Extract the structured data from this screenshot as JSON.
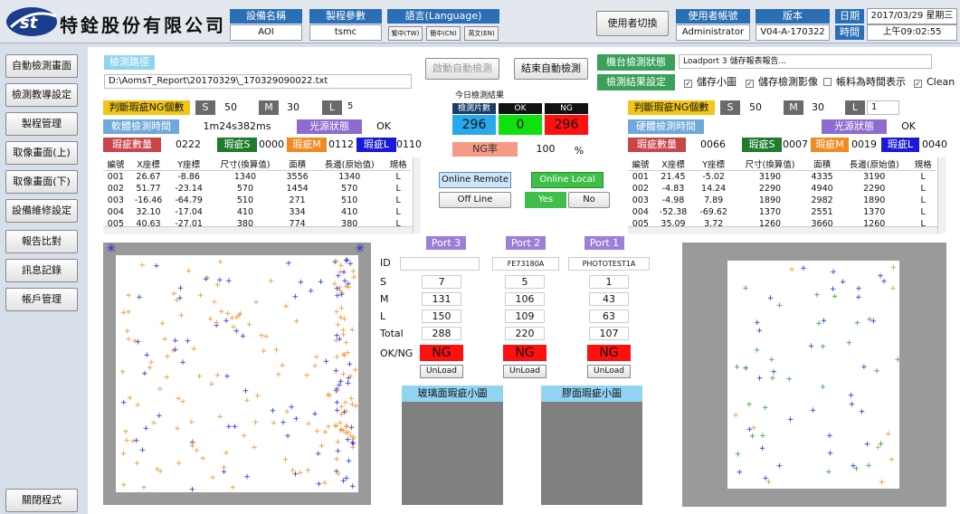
{
  "company": {
    "logo_text": "st",
    "name": "特銓股份有限公司"
  },
  "header": {
    "device_label": "設備名稱",
    "device_value": "AOI",
    "recipe_label": "製程參數",
    "recipe_value": "tsmc",
    "lang_label": "語言(Language)",
    "lang_tw": "繁中(TW)",
    "lang_cn": "簡中(CN)",
    "lang_en": "英文(EN)",
    "switch_user": "使用者切換",
    "account_label": "使用者帳號",
    "account_value": "Administrator",
    "version_label": "版本",
    "version_value": "V04-A-170322",
    "date_label": "日期",
    "date_value": "2017/03/29 星期三",
    "time_label": "時間",
    "time_value": "上午09:02:55"
  },
  "sidebar": [
    "自動檢測畫面",
    "檢測教導設定",
    "製程管理",
    "取像畫面(上)",
    "取像畫面(下)",
    "設備維修設定",
    "報告比對",
    "訊息記錄",
    "帳戶管理"
  ],
  "close_button": "關閉程式",
  "path": {
    "label": "檢測路徑",
    "value": "D:\\AomsT_Report\\20170329\\_170329090022.txt"
  },
  "auto": {
    "start": "啟動自動檢測",
    "end": "結束自動檢測"
  },
  "machine": {
    "status_label": "機台檢測狀態",
    "status_value": "Loadport 3 儲存報表報告...",
    "result_label": "檢測結果設定"
  },
  "options": [
    {
      "label": "儲存小圖",
      "checked": true
    },
    {
      "label": "儲存檢測影像",
      "checked": true
    },
    {
      "label": "帳料為時間表示",
      "checked": false
    },
    {
      "label": "Clean",
      "checked": true
    }
  ],
  "today": {
    "title": "今日檢測結果",
    "count_label": "檢測片數",
    "ok_label": "OK",
    "ng_label": "NG",
    "count": "296",
    "ok": "0",
    "ng": "296",
    "rate_label": "NG率",
    "rate": "100",
    "rate_unit": "%"
  },
  "online": {
    "remote": "Online Remote",
    "local": "Online Local",
    "offline": "Off Line",
    "yes": "Yes",
    "no": "No"
  },
  "left": {
    "ng_label": "判斷瑕疵NG個數",
    "s": "S",
    "s_val": "50",
    "m": "M",
    "m_val": "30",
    "l": "L",
    "l_val": "5",
    "time_label": "軟體檢測時間",
    "time_val": "1m24s382ms",
    "light_label": "光源狀態",
    "light_val": "OK",
    "count_label": "瑕疵數量",
    "count_val": "0222",
    "ds": "瑕疵S",
    "ds_val": "0000",
    "dm": "瑕疵M",
    "dm_val": "0112",
    "dl": "瑕疵L",
    "dl_val": "0110",
    "columns": [
      "編號",
      "X座標",
      "Y座標",
      "尺寸(換算值)",
      "面積",
      "長邊(原始值)",
      "規格"
    ],
    "rows": [
      [
        "001",
        "26.67",
        "-8.86",
        "1340",
        "3556",
        "1340",
        "L"
      ],
      [
        "002",
        "51.77",
        "-23.14",
        "570",
        "1454",
        "570",
        "L"
      ],
      [
        "003",
        "-16.46",
        "-64.79",
        "510",
        "271",
        "510",
        "L"
      ],
      [
        "004",
        "32.10",
        "-17.04",
        "410",
        "334",
        "410",
        "L"
      ],
      [
        "005",
        "40.63",
        "-27.01",
        "380",
        "774",
        "380",
        "L"
      ]
    ]
  },
  "right": {
    "ng_label": "判斷瑕疵NG個數",
    "s": "S",
    "s_val": "50",
    "m": "M",
    "m_val": "30",
    "l": "L",
    "l_val": "1",
    "time_label": "硬體檢測時間",
    "light_label": "光源狀態",
    "light_val": "OK",
    "count_label": "瑕疵數量",
    "count_val": "0066",
    "ds": "瑕疵S",
    "ds_val": "0007",
    "dm": "瑕疵M",
    "dm_val": "0019",
    "dl": "瑕疵L",
    "dl_val": "0040",
    "columns": [
      "編號",
      "X座標",
      "Y座標",
      "尺寸(換算值)",
      "面積",
      "長邊(原始值)",
      "規格"
    ],
    "rows": [
      [
        "001",
        "21.45",
        "-5.02",
        "3190",
        "4335",
        "3190",
        "L"
      ],
      [
        "002",
        "-4.83",
        "14.24",
        "2290",
        "4940",
        "2290",
        "L"
      ],
      [
        "003",
        "-4.98",
        "7.89",
        "1890",
        "2982",
        "1890",
        "L"
      ],
      [
        "004",
        "-52.38",
        "-69.62",
        "1370",
        "2551",
        "1370",
        "L"
      ],
      [
        "005",
        "35.09",
        "3.72",
        "1260",
        "3660",
        "1260",
        "L"
      ]
    ]
  },
  "ports": {
    "row_labels": [
      "ID",
      "S",
      "M",
      "L",
      "Total",
      "OK/NG"
    ],
    "list": [
      {
        "name": "Port 3",
        "id": "",
        "s": "7",
        "m": "131",
        "l": "150",
        "total": "288",
        "result": "NG",
        "unload": "UnLoad"
      },
      {
        "name": "Port 2",
        "id": "FE73180A",
        "s": "5",
        "m": "106",
        "l": "109",
        "total": "220",
        "result": "NG",
        "unload": "UnLoad"
      },
      {
        "name": "Port 1",
        "id": "PHOTOTEST1A",
        "s": "1",
        "m": "43",
        "l": "63",
        "total": "107",
        "result": "NG",
        "unload": "UnLoad"
      }
    ]
  },
  "mini": {
    "glass": "玻璃面瑕疵小圖",
    "film": "膠面瑕疵小圖"
  },
  "colors": {
    "blue_mark": "#2222dd",
    "orange_mark": "#f0902a",
    "green_mark": "#2a9a3a"
  }
}
